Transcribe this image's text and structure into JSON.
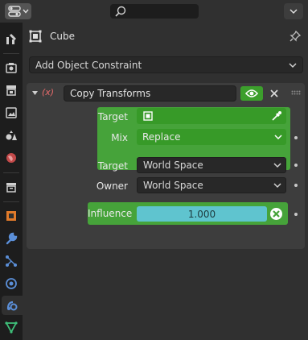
{
  "header": {
    "editor_type_icon": "properties-editor-icon",
    "search_placeholder": "",
    "options_icon": "chevron-down-icon"
  },
  "tabs": [
    {
      "name": "tool",
      "icon": "tool-icon"
    },
    {
      "name": "render",
      "icon": "render-icon"
    },
    {
      "name": "output",
      "icon": "output-icon"
    },
    {
      "name": "view-layer",
      "icon": "view-layer-icon"
    },
    {
      "name": "scene",
      "icon": "scene-icon"
    },
    {
      "name": "world",
      "icon": "world-icon"
    },
    {
      "name": "collection",
      "icon": "collection-icon"
    },
    {
      "name": "object",
      "icon": "object-icon"
    },
    {
      "name": "modifiers",
      "icon": "wrench-icon"
    },
    {
      "name": "particles",
      "icon": "particles-icon"
    },
    {
      "name": "physics",
      "icon": "physics-icon"
    },
    {
      "name": "object-constraints",
      "icon": "constraint-icon",
      "active": true
    },
    {
      "name": "object-data",
      "icon": "mesh-data-icon"
    }
  ],
  "object": {
    "name": "Cube"
  },
  "add_constraint": {
    "label": "Add Object Constraint"
  },
  "constraint": {
    "icon_text": "(x)",
    "name": "Copy Transforms",
    "target_label": "Target",
    "target_value": "",
    "mix_label": "Mix",
    "mix_value": "Replace",
    "target_space_label": "Target",
    "target_space_value": "World Space",
    "owner_space_label": "Owner",
    "owner_space_value": "World Space",
    "influence_label": "Influence",
    "influence_value": "1.000"
  },
  "colors": {
    "accent_green": "#46a33a",
    "slider": "#5fc4cf",
    "panel": "#3d3d3d",
    "background": "#303030"
  }
}
